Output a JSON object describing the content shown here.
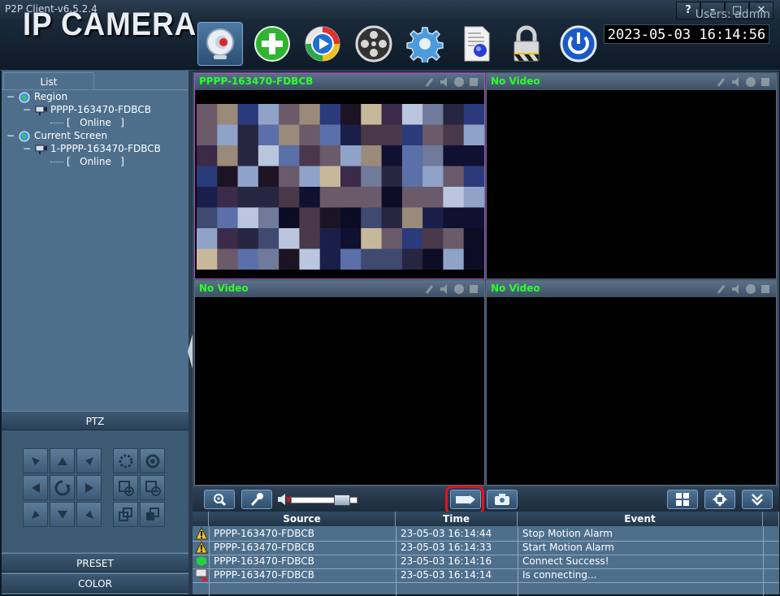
{
  "window": {
    "title": "P2P Client-v6.5.2.4",
    "help_label": "?",
    "minimize_label": "–",
    "maximize_label": "□",
    "close_label": "✕"
  },
  "header": {
    "logo": "IP CAMERA",
    "users": "Users: admin",
    "datetime": "2023-05-03  16:14:56",
    "tools": [
      "camera-icon",
      "add-icon",
      "playback-icon",
      "film-reel-icon",
      "settings-gear-icon",
      "log-document-icon",
      "lock-icon",
      "power-icon"
    ]
  },
  "left": {
    "tab_label": "List",
    "tree": {
      "region_label": "Region",
      "region_device": "PPPP-163470-FDBCB",
      "region_status": "[   Online   ]",
      "screen_label": "Current Screen",
      "screen_device": "1-PPPP-163470-FDBCB",
      "screen_status": "[   Online   ]"
    },
    "ptz_label": "PTZ",
    "preset_label": "PRESET",
    "color_label": "COLOR"
  },
  "video": {
    "panels": [
      {
        "title": "PPPP-163470-FDBCB"
      },
      {
        "title": "No Video"
      },
      {
        "title": "No Video"
      },
      {
        "title": "No Video"
      }
    ]
  },
  "controls": {
    "volume_level": 0.78
  },
  "log": {
    "headers": [
      "Source",
      "Time",
      "Event"
    ],
    "rows": [
      {
        "icon": "warning-icon",
        "source": "PPPP-163470-FDBCB",
        "time": "23-05-03 16:14:44",
        "event": "Stop Motion Alarm"
      },
      {
        "icon": "warning-icon",
        "source": "PPPP-163470-FDBCB",
        "time": "23-05-03 16:14:33",
        "event": "Start Motion Alarm"
      },
      {
        "icon": "connected-icon",
        "source": "PPPP-163470-FDBCB",
        "time": "23-05-03 16:14:16",
        "event": "Connect Success!"
      },
      {
        "icon": "connecting-icon",
        "source": "PPPP-163470-FDBCB",
        "time": "23-05-03 16:14:14",
        "event": "Is connecting..."
      }
    ]
  },
  "colors": {
    "accent_green": "#2bff2b",
    "selected_border": "#b84ad0",
    "highlight_red": "#e8101a"
  }
}
